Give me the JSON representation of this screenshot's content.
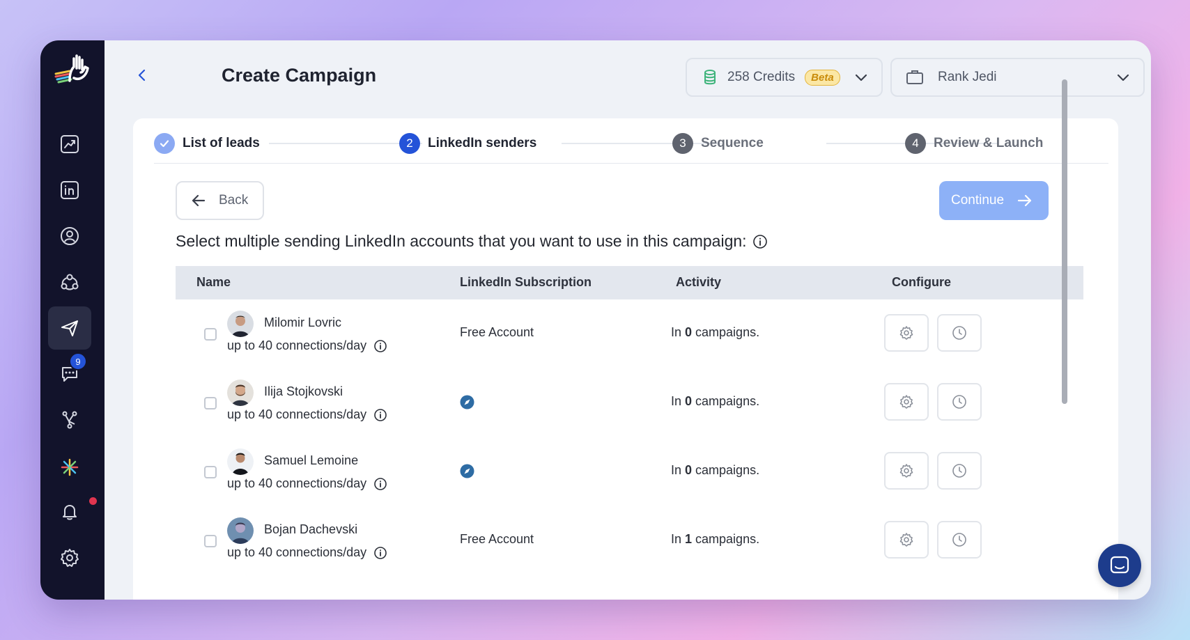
{
  "header": {
    "title": "Create Campaign",
    "credits_label": "258 Credits",
    "beta_label": "Beta",
    "account_label": "Rank Jedi"
  },
  "sidebar": {
    "items": [
      {
        "name": "analytics",
        "icon": "chart-icon"
      },
      {
        "name": "linkedin",
        "icon": "linkedin-icon"
      },
      {
        "name": "profile",
        "icon": "user-circle-icon"
      },
      {
        "name": "network",
        "icon": "network-icon"
      },
      {
        "name": "campaigns",
        "icon": "send-icon",
        "active": true
      },
      {
        "name": "inbox",
        "icon": "chat-icon",
        "badge": "9"
      },
      {
        "name": "integrations",
        "icon": "webhook-icon"
      },
      {
        "name": "ai",
        "icon": "sparkle-icon"
      },
      {
        "name": "notifications",
        "icon": "bell-icon"
      },
      {
        "name": "settings",
        "icon": "gear-icon"
      }
    ]
  },
  "stepper": {
    "steps": [
      {
        "number": "",
        "label": "List of leads",
        "state": "done"
      },
      {
        "number": "2",
        "label": "LinkedIn senders",
        "state": "current"
      },
      {
        "number": "3",
        "label": "Sequence",
        "state": "pending"
      },
      {
        "number": "4",
        "label": "Review & Launch",
        "state": "pending"
      }
    ]
  },
  "actions": {
    "back_label": "Back",
    "continue_label": "Continue"
  },
  "instruction": "Select multiple sending LinkedIn accounts that you want to use in this campaign:",
  "table": {
    "columns": [
      "Name",
      "LinkedIn Subscription",
      "Activity",
      "Configure"
    ],
    "rows": [
      {
        "name": "Milomir Lovric",
        "limit": "up to 40 connections/day",
        "subscription": "Free Account",
        "activity_prefix": "In ",
        "activity_count": "0",
        "activity_suffix": " campaigns."
      },
      {
        "name": "Ilija Stojkovski",
        "limit": "up to 40 connections/day",
        "subscription": "",
        "activity_prefix": "In ",
        "activity_count": "0",
        "activity_suffix": " campaigns."
      },
      {
        "name": "Samuel Lemoine",
        "limit": "up to 40 connections/day",
        "subscription": "",
        "activity_prefix": "In ",
        "activity_count": "0",
        "activity_suffix": " campaigns."
      },
      {
        "name": "Bojan Dachevski",
        "limit": "up to 40 connections/day",
        "subscription": "Free Account",
        "activity_prefix": "In ",
        "activity_count": "1",
        "activity_suffix": " campaigns."
      }
    ]
  },
  "colors": {
    "accent": "#2453d8",
    "sidebar_bg": "#12132b",
    "continue_disabled": "#8db1f7"
  }
}
